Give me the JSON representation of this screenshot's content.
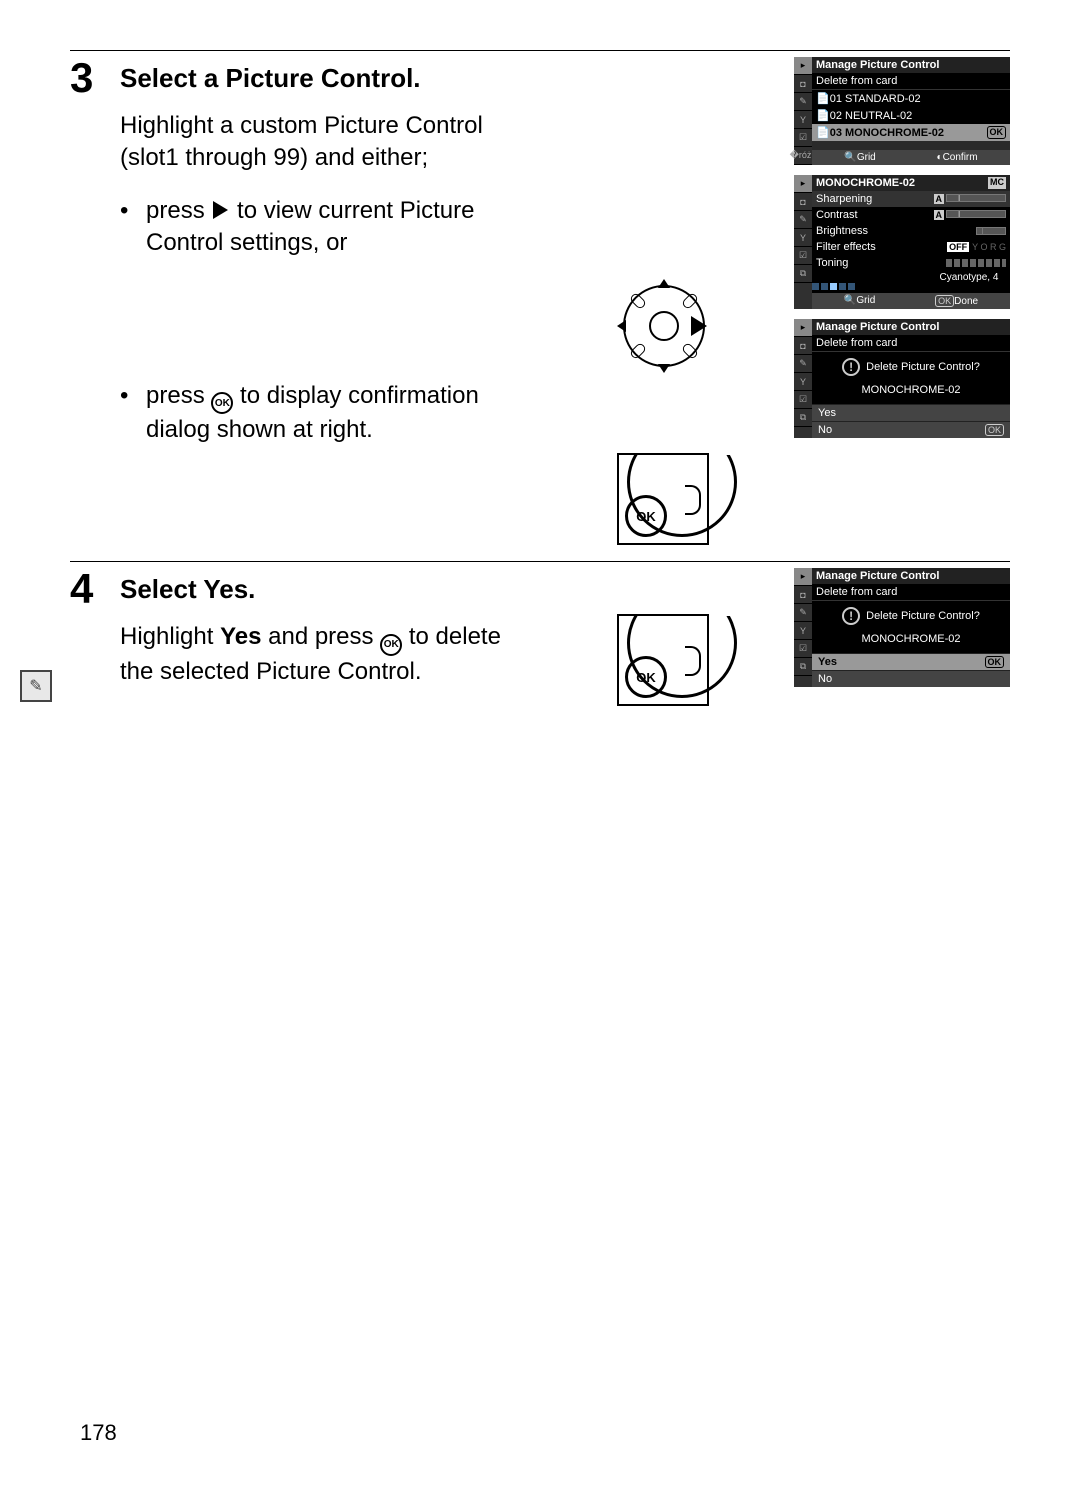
{
  "page_number": "178",
  "step3": {
    "num": "3",
    "title": "Select a Picture Control.",
    "para": "Highlight a custom Picture Control (slot1 through 99) and either;",
    "bullet1_a": "press ",
    "bullet1_b": " to view current Picture Control settings, or",
    "bullet2_a": "press ",
    "bullet2_b": " to display confirmation dialog shown at right."
  },
  "step4": {
    "num": "4",
    "title": "Select Yes.",
    "para_a": "Highlight ",
    "para_b": "Yes",
    "para_c": " and press ",
    "para_d": " to delete the selected Picture Control."
  },
  "lcd1": {
    "title": "Manage Picture Control",
    "sub": "Delete from card",
    "r1": "01 STANDARD-02",
    "r2": "02 NEUTRAL-02",
    "r3": "03 MONOCHROME-02",
    "foot_grid": "Grid",
    "foot_conf": "Confirm",
    "ok": "OK"
  },
  "lcd2": {
    "title": "MONOCHROME-02",
    "badge": "MC",
    "rows": {
      "sharp": "Sharpening",
      "contrast": "Contrast",
      "bright": "Brightness",
      "filter": "Filter effects",
      "toning": "Toning"
    },
    "off": "OFF",
    "cyan": "Cyanotype, 4",
    "foot_grid": "Grid",
    "foot_done": "Done",
    "ok": "OK",
    "a": "A"
  },
  "lcd3": {
    "title": "Manage Picture Control",
    "sub": "Delete from card",
    "q": "Delete Picture Control?",
    "name": "MONOCHROME-02",
    "yes": "Yes",
    "no": "No",
    "ok": "OK"
  },
  "lcd4": {
    "title": "Manage Picture Control",
    "sub": "Delete from card",
    "q": "Delete Picture Control?",
    "name": "MONOCHROME-02",
    "yes": "Yes",
    "no": "No",
    "ok": "OK"
  },
  "okbtn": "OK"
}
